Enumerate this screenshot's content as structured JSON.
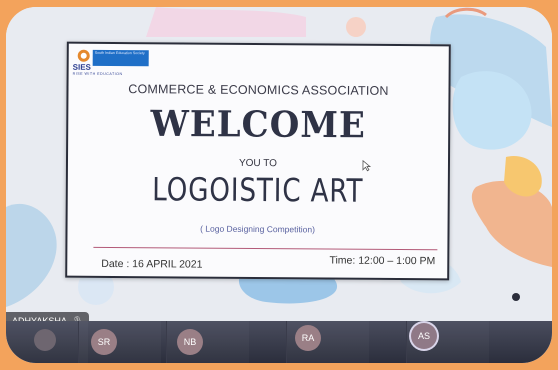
{
  "slide": {
    "logo_text": "SIES",
    "logo_small_text": "South Indian Education Society",
    "logo_motto": "RISE WITH EDUCATION",
    "association": "COMMERCE & ECONOMICS ASSOCIATION",
    "welcome": "WELCOME",
    "you_to": "YOU TO",
    "event_name": "LOGOISTIC ART",
    "subtitle": "( Logo Designing Competition)",
    "date": "Date : 16 APRIL 2021",
    "time": "Time: 12:00 – 1:00 PM"
  },
  "speaker": {
    "name": "ADHYAKSHA",
    "icon": "mic-muted-icon"
  },
  "participants": [
    {
      "initials": "SR"
    },
    {
      "initials": "NB"
    },
    {
      "initials": "RA"
    },
    {
      "initials": "AS",
      "active": true
    }
  ],
  "colors": {
    "frame": "#f3a35c",
    "logo_blue": "#1f6fc7",
    "rule": "#b35a78",
    "bar": "#2b2e3c"
  }
}
